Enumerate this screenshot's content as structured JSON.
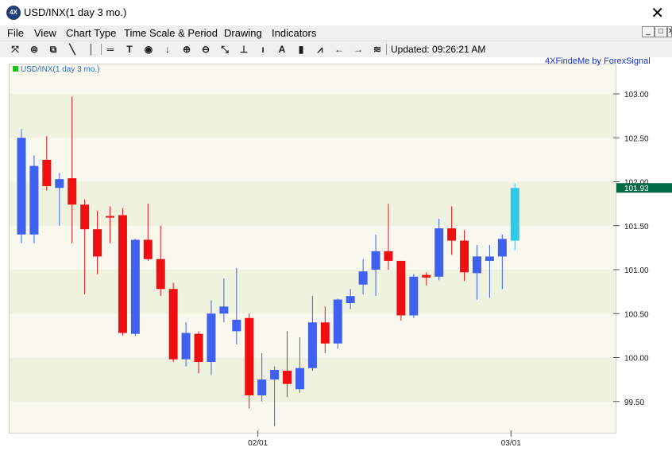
{
  "window": {
    "title": "USD/INX(1 day  3 mo.)",
    "close_glyph": "✕",
    "icon_text": "4X"
  },
  "menu": [
    "File",
    "View",
    "Chart Type",
    "Time Scale & Period",
    "Drawing",
    "Indicators"
  ],
  "mdi_buttons": [
    "_",
    "□",
    "✕"
  ],
  "toolbar": {
    "icons": [
      "cursor-icon",
      "print-icon",
      "copy-icon",
      "line-icon",
      "vertical-line-icon",
      "horizontal-line-icon",
      "text-icon",
      "circle-icon",
      "arrow-down-icon",
      "zoom-in-icon",
      "zoom-out-icon",
      "fit-icon",
      "scale-icon",
      "info-icon",
      "font-icon",
      "bar-chart-icon",
      "indicator-icon",
      "scroll-left-icon",
      "scroll-right-icon",
      "settings-icon"
    ],
    "glyphs": [
      "⤧",
      "⊜",
      "⧉",
      "╲",
      "│",
      "═",
      "T",
      "◉",
      "↓",
      "⊕",
      "⊖",
      "⤡",
      "⊥",
      "ı",
      "A",
      "▮",
      "⩘",
      "←",
      "→",
      "≋"
    ],
    "updated_label": "Updated: 09:26:21 AM"
  },
  "provider_text": "4XFindeMe by ForexSignal",
  "chart_data": {
    "type": "candlestick",
    "title": "USD/INX(1 day  3 mo.)",
    "xlabel": "",
    "ylabel": "",
    "ylim": [
      99.2,
      103.3
    ],
    "yticks": [
      103.0,
      102.5,
      102.0,
      101.5,
      101.0,
      100.5,
      100.0,
      99.5
    ],
    "ytick_labels": [
      "103.00",
      "102.50",
      "102.00",
      "101.50",
      "101.00",
      "100.50",
      "100.00",
      "99.50"
    ],
    "xtick_labels": [
      {
        "index": 19,
        "label": "02/01"
      },
      {
        "index": 39,
        "label": "03/01"
      }
    ],
    "current_price": 101.93,
    "current_price_label": "101.93",
    "legend": {
      "label": "USD/INX(1 day  3 mo.)",
      "position": "top-left",
      "color": "#20c020"
    },
    "grid": true,
    "colors": {
      "up": "#4060f0",
      "down": "#ee1010",
      "current": "#30c8e8",
      "price_tag": "#006845"
    },
    "candles": [
      {
        "o": 101.4,
        "h": 102.6,
        "l": 101.3,
        "c": 102.5
      },
      {
        "o": 101.4,
        "h": 102.3,
        "l": 101.3,
        "c": 102.18
      },
      {
        "o": 102.25,
        "h": 102.52,
        "l": 101.9,
        "c": 101.95
      },
      {
        "o": 101.93,
        "h": 102.1,
        "l": 101.5,
        "c": 102.03
      },
      {
        "o": 102.04,
        "h": 102.97,
        "l": 101.3,
        "c": 101.74
      },
      {
        "o": 101.74,
        "h": 101.8,
        "l": 100.72,
        "c": 101.46
      },
      {
        "o": 101.46,
        "h": 101.67,
        "l": 100.95,
        "c": 101.15
      },
      {
        "o": 101.61,
        "h": 101.72,
        "l": 101.3,
        "c": 101.6
      },
      {
        "o": 101.62,
        "h": 101.7,
        "l": 100.25,
        "c": 100.28
      },
      {
        "o": 100.27,
        "h": 101.35,
        "l": 100.25,
        "c": 101.34
      },
      {
        "o": 101.34,
        "h": 101.75,
        "l": 101.1,
        "c": 101.12
      },
      {
        "o": 101.12,
        "h": 101.5,
        "l": 100.7,
        "c": 100.78
      },
      {
        "o": 100.78,
        "h": 100.85,
        "l": 99.95,
        "c": 99.98
      },
      {
        "o": 99.98,
        "h": 100.4,
        "l": 99.9,
        "c": 100.28
      },
      {
        "o": 100.27,
        "h": 100.3,
        "l": 99.82,
        "c": 99.95
      },
      {
        "o": 99.95,
        "h": 100.65,
        "l": 99.8,
        "c": 100.5
      },
      {
        "o": 100.5,
        "h": 100.9,
        "l": 100.4,
        "c": 100.58
      },
      {
        "o": 100.3,
        "h": 101.02,
        "l": 100.15,
        "c": 100.43
      },
      {
        "o": 100.45,
        "h": 100.5,
        "l": 99.42,
        "c": 99.57
      },
      {
        "o": 99.57,
        "h": 100.05,
        "l": 99.5,
        "c": 99.75
      },
      {
        "o": 99.75,
        "h": 99.9,
        "l": 99.22,
        "c": 99.86
      },
      {
        "o": 99.85,
        "h": 100.3,
        "l": 99.55,
        "c": 99.7
      },
      {
        "o": 99.64,
        "h": 100.23,
        "l": 99.6,
        "c": 99.88
      },
      {
        "o": 99.88,
        "h": 100.7,
        "l": 99.85,
        "c": 100.4
      },
      {
        "o": 100.4,
        "h": 100.58,
        "l": 100.05,
        "c": 100.16
      },
      {
        "o": 100.16,
        "h": 100.67,
        "l": 100.1,
        "c": 100.66
      },
      {
        "o": 100.62,
        "h": 100.78,
        "l": 100.55,
        "c": 100.7
      },
      {
        "o": 100.83,
        "h": 101.12,
        "l": 100.72,
        "c": 100.98
      },
      {
        "o": 101.0,
        "h": 101.4,
        "l": 100.7,
        "c": 101.21
      },
      {
        "o": 101.21,
        "h": 101.75,
        "l": 101.0,
        "c": 101.1
      },
      {
        "o": 101.1,
        "h": 101.1,
        "l": 100.42,
        "c": 100.48
      },
      {
        "o": 100.48,
        "h": 100.95,
        "l": 100.45,
        "c": 100.92
      },
      {
        "o": 100.94,
        "h": 100.97,
        "l": 100.82,
        "c": 100.91
      },
      {
        "o": 100.92,
        "h": 101.58,
        "l": 100.88,
        "c": 101.47
      },
      {
        "o": 101.47,
        "h": 101.72,
        "l": 101.17,
        "c": 101.33
      },
      {
        "o": 101.33,
        "h": 101.45,
        "l": 100.87,
        "c": 100.97
      },
      {
        "o": 100.96,
        "h": 101.28,
        "l": 100.66,
        "c": 101.15
      },
      {
        "o": 101.1,
        "h": 101.28,
        "l": 100.68,
        "c": 101.15
      },
      {
        "o": 101.15,
        "h": 101.4,
        "l": 100.78,
        "c": 101.35
      },
      {
        "o": 101.33,
        "h": 101.98,
        "l": 101.22,
        "c": 101.93
      }
    ]
  }
}
